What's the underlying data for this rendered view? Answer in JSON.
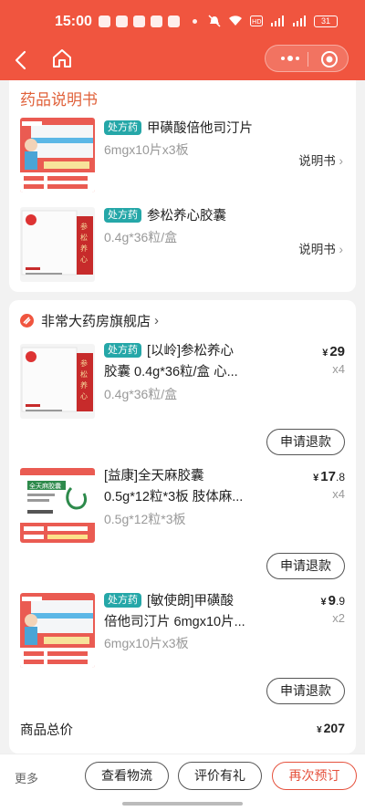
{
  "status_bar": {
    "time": "15:00",
    "battery": "31"
  },
  "manual_section": {
    "title": "药品说明书",
    "items": [
      {
        "rx_badge": "处方药",
        "name": "甲磺酸倍他司汀片",
        "spec": "6mgx10片x3板",
        "manual_link": "说明书",
        "thumb": "orange-box"
      },
      {
        "rx_badge": "处方药",
        "name": "参松养心胶囊",
        "spec": "0.4g*36粒/盒",
        "manual_link": "说明书",
        "thumb": "white-box"
      }
    ]
  },
  "order": {
    "store_name": "非常大药房旗舰店",
    "items": [
      {
        "rx_badge": "处方药",
        "name_line1": "[以岭]参松养心",
        "name_line2": "胶囊 0.4g*36粒/盒 心...",
        "spec": "0.4g*36粒/盒",
        "price_yen": "¥",
        "price_int": "29",
        "price_dec": "",
        "qty": "x4",
        "refund": "申请退款"
      },
      {
        "rx_badge": "",
        "name_line1": "[益康]全天麻胶囊",
        "name_line2": "0.5g*12粒*3板 肢体麻...",
        "spec": "0.5g*12粒*3板",
        "price_yen": "¥",
        "price_int": "17",
        "price_dec": ".8",
        "qty": "x4",
        "refund": "申请退款"
      },
      {
        "rx_badge": "处方药",
        "name_line1": "[敏使朗]甲磺酸",
        "name_line2": "倍他司汀片 6mgx10片...",
        "spec": "6mgx10片x3板",
        "price_yen": "¥",
        "price_int": "9",
        "price_dec": ".9",
        "qty": "x2",
        "refund": "申请退款"
      }
    ],
    "total_label": "商品总价",
    "total_yen": "¥",
    "total_value": "207"
  },
  "bottom_bar": {
    "more": "更多",
    "logistics": "查看物流",
    "review": "评价有礼",
    "reorder": "再次预订"
  },
  "colors": {
    "brand": "#f0553f",
    "rx_badge": "#25a7a8",
    "manual_title": "#e0613a"
  }
}
